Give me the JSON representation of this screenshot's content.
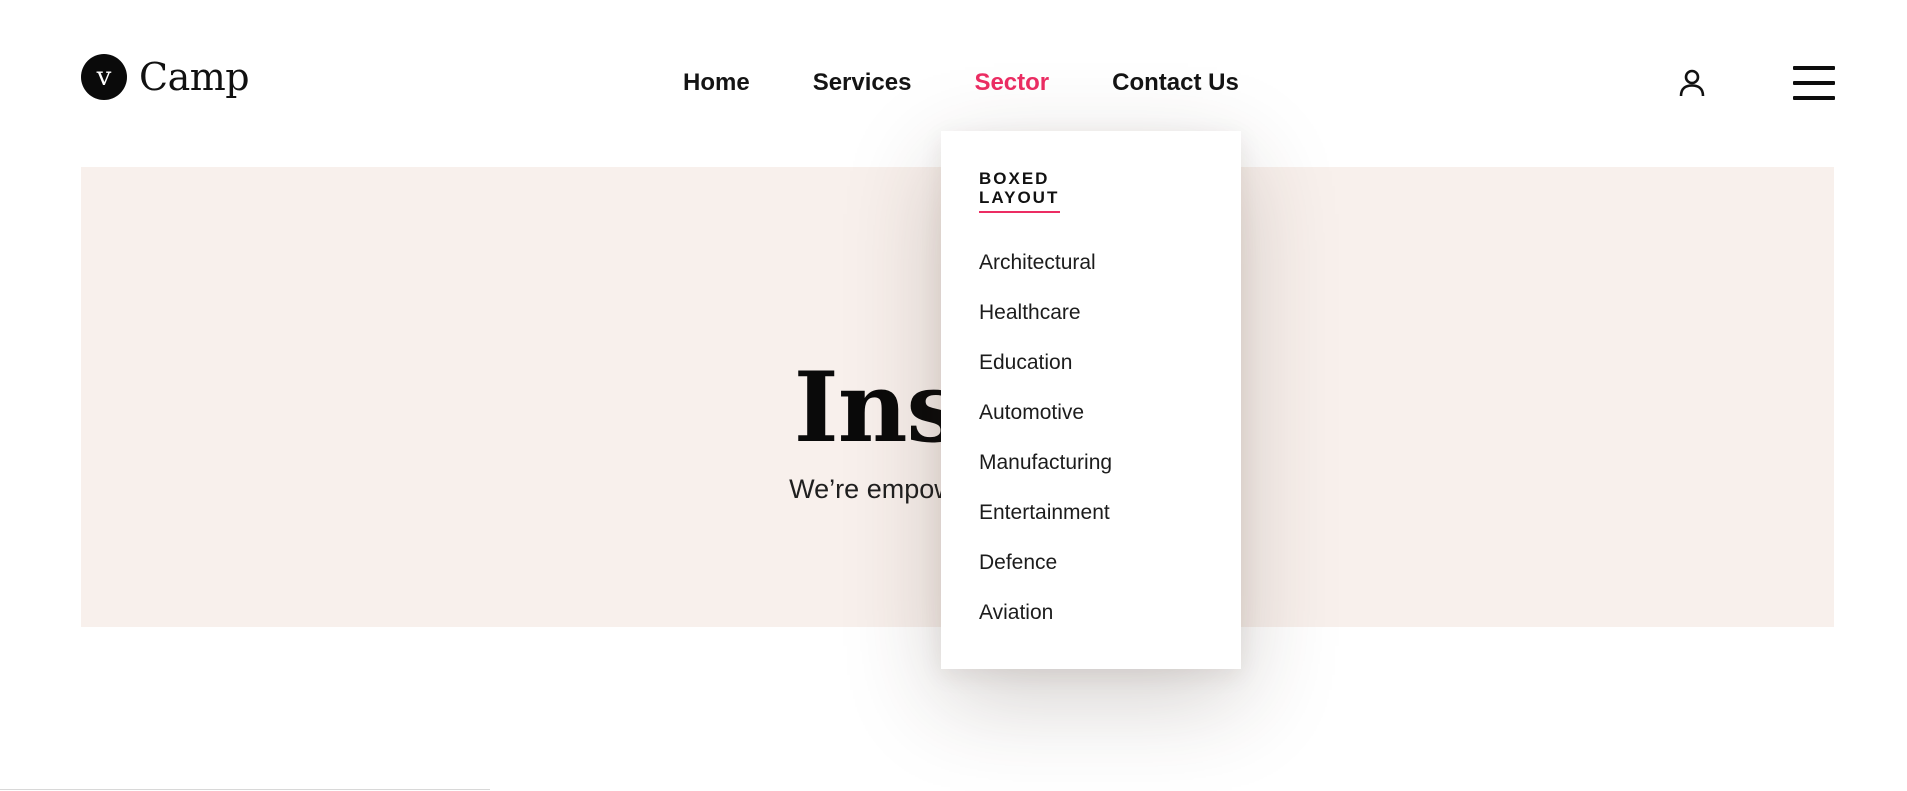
{
  "header": {
    "logo": {
      "mark": "v",
      "text": "Camp"
    },
    "nav": [
      {
        "label": "Home",
        "active": false
      },
      {
        "label": "Services",
        "active": false
      },
      {
        "label": "Sector",
        "active": true
      },
      {
        "label": "Contact Us",
        "active": false
      }
    ],
    "icons": {
      "account": "user-icon",
      "menu": "hamburger-menu-icon"
    }
  },
  "hero": {
    "title": "Inside",
    "subtitle": "We’re empowering Avriti                              her"
  },
  "dropdown": {
    "heading": "BOXED LAYOUT",
    "items": [
      "Architectural",
      "Healthcare",
      "Education",
      "Automotive",
      "Manufacturing",
      "Entertainment",
      "Defence",
      "Aviation"
    ]
  },
  "colors": {
    "accent": "#ec2d63",
    "hero_bg": "#f8f0ec",
    "text": "#111111"
  }
}
